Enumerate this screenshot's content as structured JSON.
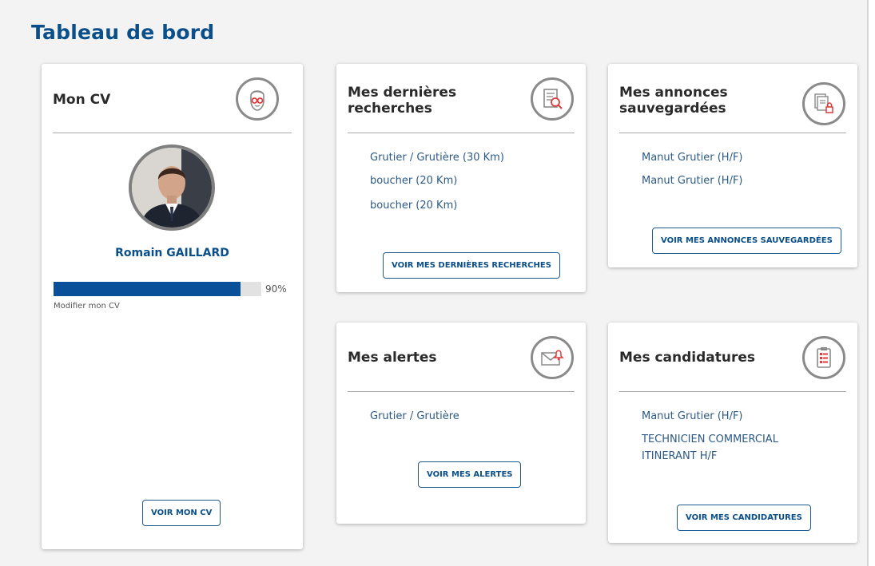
{
  "page": {
    "title": "Tableau de bord"
  },
  "cv_card": {
    "title": "Mon CV",
    "icon": "cv-face-icon",
    "name": "Romain GAILLARD",
    "progress": {
      "value": 90,
      "label": "90%"
    },
    "edit_link": "Modifier mon CV",
    "button": "VOIR MON CV"
  },
  "searches_card": {
    "title": "Mes dernières recherches",
    "icon": "document-search-icon",
    "items": [
      "Grutier / Grutière (30 Km)",
      "boucher (20 Km)",
      "boucher (20 Km)"
    ],
    "button": "VOIR MES DERNIÈRES RECHERCHES"
  },
  "saved_card": {
    "title": "Mes annonces sauvegardées",
    "icon": "saved-documents-lock-icon",
    "items": [
      "Manut Grutier (H/F)",
      "Manut Grutier (H/F)"
    ],
    "button": "VOIR MES ANNONCES SAUVEGARDÉES"
  },
  "alerts_card": {
    "title": "Mes alertes",
    "icon": "envelope-bell-icon",
    "items": [
      "Grutier / Grutière"
    ],
    "button": "VOIR MES ALERTES"
  },
  "applications_card": {
    "title": "Mes candidatures",
    "icon": "clipboard-list-icon",
    "items": [
      "Manut Grutier (H/F)",
      "TECHNICIEN COMMERCIAL ITINERANT H/F"
    ],
    "button": "VOIR MES CANDIDATURES"
  },
  "colors": {
    "primary": "#0b4f8a",
    "progress": "#0a4f9a",
    "accent_red": "#e03a3a",
    "link": "#2c5a86"
  }
}
